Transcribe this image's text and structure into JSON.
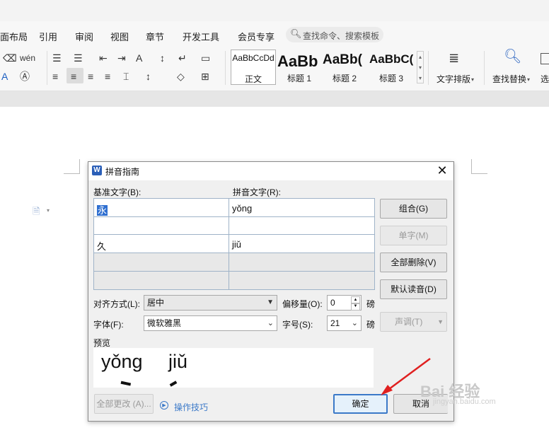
{
  "menu": {
    "items": [
      "面布局",
      "引用",
      "审阅",
      "视图",
      "章节",
      "开发工具",
      "会员专享"
    ],
    "search_placeholder": "查找命令、搜索模板"
  },
  "ribbon": {
    "styles": [
      {
        "sample": "AaBbCcDd",
        "name": "正文"
      },
      {
        "sample": "AaBb",
        "name": "标题 1"
      },
      {
        "sample": "AaBb(",
        "name": "标题 2"
      },
      {
        "sample": "AaBbC(",
        "name": "标题 3"
      }
    ],
    "text_layout_label": "文字排版",
    "find_replace_label": "查找替换",
    "select_label": "选"
  },
  "dialog": {
    "title": "拼音指南",
    "base_text_header": "基准文字(B):",
    "ruby_text_header": "拼音文字(R):",
    "rows": [
      {
        "base": "永",
        "ruby": "yǒng"
      },
      {
        "base": "",
        "ruby": ""
      },
      {
        "base": "久",
        "ruby": "jiǔ"
      },
      {
        "base": "",
        "ruby": ""
      },
      {
        "base": "",
        "ruby": ""
      }
    ],
    "buttons": {
      "group": "组合(G)",
      "single": "单字(M)",
      "delete_all": "全部删除(V)",
      "default_reading": "默认读音(D)",
      "tone": "声调(T)",
      "change_all": "全部更改 (A)...",
      "ok": "确定",
      "cancel": "取消"
    },
    "align_label": "对齐方式(L):",
    "align_value": "居中",
    "offset_label": "偏移量(O):",
    "offset_value": "0",
    "offset_unit": "磅",
    "font_label": "字体(F):",
    "font_value": "微软雅黑",
    "size_label": "字号(S):",
    "size_value": "21",
    "size_unit": "磅",
    "preview_label": "预览",
    "preview_ruby_1": "yǒng",
    "preview_ruby_2": "jiǔ",
    "tips_link": "操作技巧"
  },
  "watermark": {
    "text": "Bai 经验",
    "sub": "jingyan.baidu.com"
  },
  "colors": {
    "accent": "#3b79c8",
    "arrow": "#e02020",
    "dialog_bg": "#f0f0f0"
  }
}
